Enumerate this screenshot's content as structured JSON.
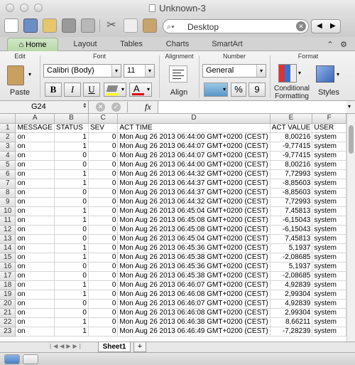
{
  "window": {
    "title": "Unknown-3"
  },
  "search": {
    "placeholder": "Desktop"
  },
  "ribbon_tabs": [
    "Home",
    "Layout",
    "Tables",
    "Charts",
    "SmartArt"
  ],
  "groups": {
    "edit": "Edit",
    "font": "Font",
    "alignment": "Alignment",
    "number": "Number",
    "format": "Format"
  },
  "edit": {
    "paste": "Paste"
  },
  "font": {
    "name": "Calibri (Body)",
    "size": "11",
    "bold": "B",
    "italic": "I",
    "underline": "U",
    "color_glyph": "A"
  },
  "alignment": {
    "align_label": "Align"
  },
  "number": {
    "format_value": "General",
    "percent": "%",
    "comma": "9"
  },
  "format": {
    "conditional_line1": "Conditional",
    "conditional_line2": "Formatting",
    "styles": "Styles"
  },
  "formula_bar": {
    "cell_ref": "G24",
    "fx": "fx",
    "content": ""
  },
  "columns": [
    "A",
    "B",
    "C",
    "D",
    "E",
    "F"
  ],
  "rows": [
    {
      "n": "1",
      "cells": [
        "MESSAGE",
        "STATUS",
        "SEV",
        "ACT TIME",
        "ACT VALUE",
        "USER"
      ]
    },
    {
      "n": "2",
      "cells": [
        "on",
        "1",
        "0",
        "Mon Aug 26 2013 06:44:00 GMT+0200 (CEST)",
        "8,00216",
        "system"
      ]
    },
    {
      "n": "3",
      "cells": [
        "on",
        "1",
        "0",
        "Mon Aug 26 2013 06:44:07 GMT+0200 (CEST)",
        "-9,77415",
        "system"
      ]
    },
    {
      "n": "4",
      "cells": [
        "on",
        "0",
        "0",
        "Mon Aug 26 2013 06:44:07 GMT+0200 (CEST)",
        "-9,77415",
        "system"
      ]
    },
    {
      "n": "5",
      "cells": [
        "on",
        "0",
        "0",
        "Mon Aug 26 2013 06:44:00 GMT+0200 (CEST)",
        "8,00216",
        "system"
      ]
    },
    {
      "n": "6",
      "cells": [
        "on",
        "1",
        "0",
        "Mon Aug 26 2013 06:44:32 GMT+0200 (CEST)",
        "7,72993",
        "system"
      ]
    },
    {
      "n": "7",
      "cells": [
        "on",
        "1",
        "0",
        "Mon Aug 26 2013 06:44:37 GMT+0200 (CEST)",
        "-8,85603",
        "system"
      ]
    },
    {
      "n": "8",
      "cells": [
        "on",
        "0",
        "0",
        "Mon Aug 26 2013 06:44:37 GMT+0200 (CEST)",
        "-8,85603",
        "system"
      ]
    },
    {
      "n": "9",
      "cells": [
        "on",
        "0",
        "0",
        "Mon Aug 26 2013 06:44:32 GMT+0200 (CEST)",
        "7,72993",
        "system"
      ]
    },
    {
      "n": "10",
      "cells": [
        "on",
        "1",
        "0",
        "Mon Aug 26 2013 06:45:04 GMT+0200 (CEST)",
        "7,45813",
        "system"
      ]
    },
    {
      "n": "11",
      "cells": [
        "on",
        "1",
        "0",
        "Mon Aug 26 2013 06:45:08 GMT+0200 (CEST)",
        "-6,15043",
        "system"
      ]
    },
    {
      "n": "12",
      "cells": [
        "on",
        "0",
        "0",
        "Mon Aug 26 2013 06:45:08 GMT+0200 (CEST)",
        "-6,15043",
        "system"
      ]
    },
    {
      "n": "13",
      "cells": [
        "on",
        "0",
        "0",
        "Mon Aug 26 2013 06:45:04 GMT+0200 (CEST)",
        "7,45813",
        "system"
      ]
    },
    {
      "n": "14",
      "cells": [
        "on",
        "1",
        "0",
        "Mon Aug 26 2013 06:45:36 GMT+0200 (CEST)",
        "5,1937",
        "system"
      ]
    },
    {
      "n": "15",
      "cells": [
        "on",
        "1",
        "0",
        "Mon Aug 26 2013 06:45:38 GMT+0200 (CEST)",
        "-2,08685",
        "system"
      ]
    },
    {
      "n": "16",
      "cells": [
        "on",
        "0",
        "0",
        "Mon Aug 26 2013 06:45:36 GMT+0200 (CEST)",
        "5,1937",
        "system"
      ]
    },
    {
      "n": "17",
      "cells": [
        "on",
        "0",
        "0",
        "Mon Aug 26 2013 06:45:38 GMT+0200 (CEST)",
        "-2,08685",
        "system"
      ]
    },
    {
      "n": "18",
      "cells": [
        "on",
        "1",
        "0",
        "Mon Aug 26 2013 06:46:07 GMT+0200 (CEST)",
        "4,92839",
        "system"
      ]
    },
    {
      "n": "19",
      "cells": [
        "on",
        "1",
        "0",
        "Mon Aug 26 2013 06:46:08 GMT+0200 (CEST)",
        "2,99304",
        "system"
      ]
    },
    {
      "n": "20",
      "cells": [
        "on",
        "0",
        "0",
        "Mon Aug 26 2013 06:46:07 GMT+0200 (CEST)",
        "4,92839",
        "system"
      ]
    },
    {
      "n": "21",
      "cells": [
        "on",
        "0",
        "0",
        "Mon Aug 26 2013 06:46:08 GMT+0200 (CEST)",
        "2,99304",
        "system"
      ]
    },
    {
      "n": "22",
      "cells": [
        "on",
        "1",
        "0",
        "Mon Aug 26 2013 06:46:38 GMT+0200 (CEST)",
        "8,66211",
        "system"
      ]
    },
    {
      "n": "23",
      "cells": [
        "on",
        "1",
        "0",
        "Mon Aug 26 2013 06:46:49 GMT+0200 (CEST)",
        "-7,28239",
        "system"
      ]
    }
  ],
  "sheets": {
    "active": "Sheet1",
    "add": "+"
  },
  "colors": {
    "ribbon_tab_active": "#b9d8a9",
    "highlight_yellow": "#ffff00",
    "font_red": "#e00000"
  }
}
